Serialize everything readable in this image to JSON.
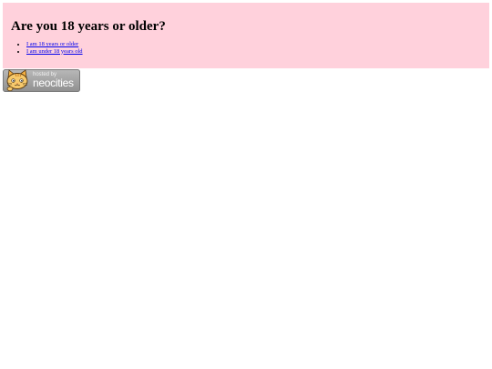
{
  "age_gate": {
    "heading": "Are you 18 years or older?",
    "options": [
      {
        "label": "I am 18 years or older"
      },
      {
        "label": "I am under 18 years old"
      }
    ],
    "background_color": "#ffd1dc"
  },
  "badge": {
    "hosted_text": "hosted by",
    "brand_text": "neocities",
    "icon": "neocities-cat-icon"
  }
}
